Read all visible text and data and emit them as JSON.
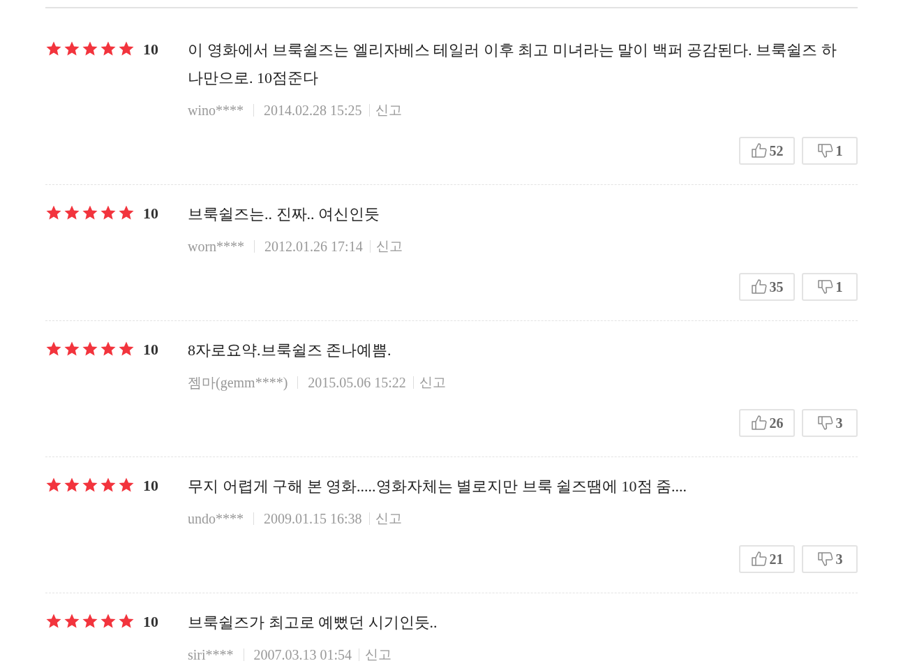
{
  "reviews": [
    {
      "stars": 5,
      "score": "10",
      "text": "이 영화에서 브룩쉴즈는 엘리자베스 테일러 이후 최고 미녀라는 말이 백퍼 공감된다. 브룩쉴즈 하나만으로. 10점준다",
      "author": "wino****",
      "date": "2014.02.28 15:25",
      "report": "신고",
      "likes": "52",
      "dislikes": "1"
    },
    {
      "stars": 5,
      "score": "10",
      "text": "브룩쉴즈는.. 진짜.. 여신인듯",
      "author": "worn****",
      "date": "2012.01.26 17:14",
      "report": "신고",
      "likes": "35",
      "dislikes": "1"
    },
    {
      "stars": 5,
      "score": "10",
      "text": "8자로요약.브룩쉴즈 존나예쁨.",
      "author": "젬마(gemm****)",
      "date": "2015.05.06 15:22",
      "report": "신고",
      "likes": "26",
      "dislikes": "3"
    },
    {
      "stars": 5,
      "score": "10",
      "text": "무지 어렵게 구해 본 영화.....영화자체는 별로지만 브룩 쉴즈땜에 10점 줌....",
      "author": "undo****",
      "date": "2009.01.15 16:38",
      "report": "신고",
      "likes": "21",
      "dislikes": "3"
    },
    {
      "stars": 5,
      "score": "10",
      "text": "브룩쉴즈가 최고로 예뻤던 시기인듯..",
      "author": "siri****",
      "date": "2007.03.13 01:54",
      "report": "신고"
    }
  ]
}
